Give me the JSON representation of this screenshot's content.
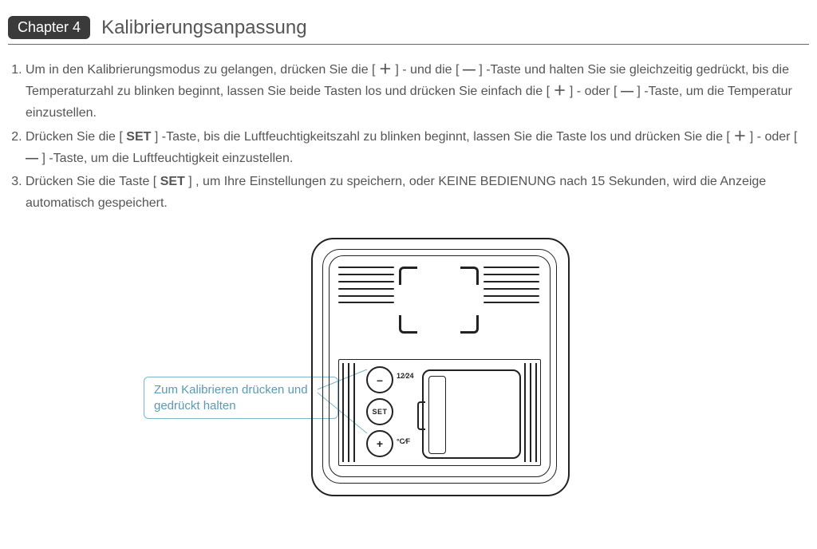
{
  "chapter": {
    "badge": "Chapter 4",
    "title": "Kalibrierungsanpassung"
  },
  "symbols": {
    "plus": "＋",
    "minus": "—",
    "set": "SET"
  },
  "steps": {
    "s1a": "Um in den Kalibrierungsmodus zu gelangen, drücken Sie die [ ",
    "s1b": " ] - und die [ ",
    "s1c": " ] -Taste und halten Sie sie gleichzeitig gedrückt, bis die Temperaturzahl zu blinken beginnt, lassen Sie beide Tasten los und drücken Sie einfach die [ ",
    "s1d": " ] - oder [ ",
    "s1e": " ] -Taste, um die Temperatur einzustellen.",
    "s2a": "Drücken Sie die [ ",
    "s2b": " ] -Taste, bis die Luftfeuchtigkeitszahl zu blinken beginnt, lassen Sie die Taste los und drücken Sie die [ ",
    "s2c": " ] - oder [ ",
    "s2d": " ] -Taste, um die Luftfeuchtigkeit einzustellen.",
    "s3a": "Drücken Sie die Taste [ ",
    "s3b": " ] , um Ihre Einstellungen zu speichern, oder KEINE BEDIENUNG nach 15 Sekunden, wird die Anzeige automatisch gespeichert."
  },
  "diagram": {
    "callout": "Zum Kalibrieren drücken und gedrückt halten",
    "btn_minus": "–",
    "btn_set": "SET",
    "btn_plus": "+",
    "label_1224": "12⁄24",
    "label_cf": "°C⁄F"
  }
}
